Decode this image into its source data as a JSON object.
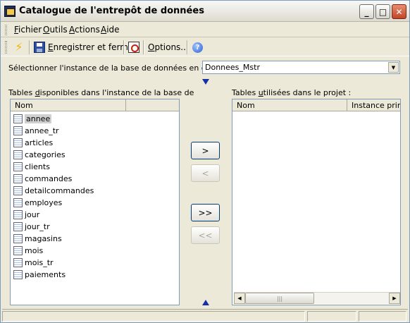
{
  "window": {
    "title": "Catalogue de l'entrepôt de données"
  },
  "title_buttons": {
    "minimize": "_",
    "maximize": "□",
    "close": "✕"
  },
  "menu": {
    "items": [
      {
        "first": "F",
        "rest": "ichier"
      },
      {
        "first": "O",
        "rest": "utils"
      },
      {
        "first": "A",
        "rest": "ctions"
      },
      {
        "first": "A",
        "rest": "ide"
      }
    ]
  },
  "toolbar": {
    "save_close_first": "E",
    "save_close_rest": "nregistrer et fermer",
    "options_first": "O",
    "options_rest": "ptions..."
  },
  "instance": {
    "label": "Sélectionner l'instance de la base de données en cours",
    "value": "Donnees_Mstr"
  },
  "available": {
    "label_a": "Tables ",
    "label_u": "d",
    "label_b": "isponibles dans l'instance de la base de",
    "column": "Nom",
    "items": [
      "annee",
      "annee_tr",
      "articles",
      "categories",
      "clients",
      "commandes",
      "detailcommandes",
      "employes",
      "jour",
      "jour_tr",
      "magasins",
      "mois",
      "mois_tr",
      "paiements"
    ],
    "selected": "annee"
  },
  "used": {
    "label_a": "Tables ",
    "label_u": "u",
    "label_b": "tilisées dans le projet :",
    "columns": [
      "Nom",
      "Instance prima"
    ]
  },
  "transfer_buttons": {
    "add": ">",
    "remove": "<",
    "add_all": ">>",
    "remove_all": "<<"
  },
  "icons": {
    "refresh": "bolt-icon",
    "save": "floppy-icon",
    "preview": "preview-icon",
    "help": "help-icon"
  },
  "colors": {
    "accent": "#1630a8",
    "window_bg": "#ece9d8",
    "border": "#7f9db9"
  }
}
